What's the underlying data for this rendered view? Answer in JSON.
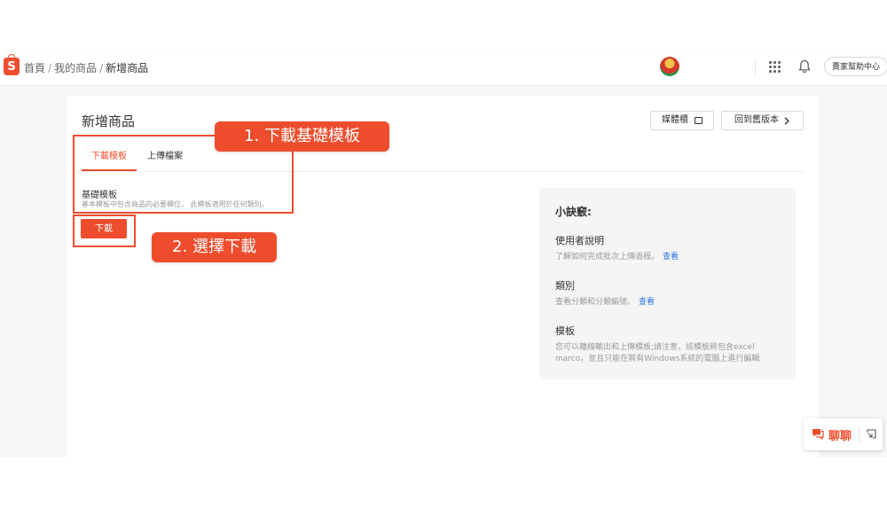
{
  "header": {
    "breadcrumb": {
      "home": "首頁",
      "products": "我的商品",
      "current": "新增商品",
      "separator": "/"
    },
    "help_label": "賣家幫助中心"
  },
  "page": {
    "title": "新增商品",
    "media_button": "媒體櫃",
    "back_button": "回到舊版本",
    "tabs": [
      {
        "label": "下載模板",
        "active": true
      },
      {
        "label": "上傳檔案",
        "active": false
      }
    ],
    "template": {
      "title": "基礎模板",
      "description": "基本模板中包含商品的必要欄位， 此模板適用於任何類別。",
      "download_button": "下載"
    }
  },
  "tips": {
    "heading": "小訣竅:",
    "items": [
      {
        "title": "使用者說明",
        "body": "了解如何完成批次上傳過程。",
        "link": "查看"
      },
      {
        "title": "類別",
        "body": "查看分類和分類編號。",
        "link": "查看"
      },
      {
        "title": "模板",
        "body": "您可以離線輸出和上傳模板;請注意，該模板將包含excel marco，並且只能在裝有Windows系統的電腦上進行編輯",
        "link": ""
      }
    ]
  },
  "annotations": {
    "step1": "1. 下載基礎模板",
    "step2": "2. 選擇下載"
  },
  "chat": {
    "label": "聊聊"
  },
  "colors": {
    "brand": "#ee4d2d",
    "link": "#2673dd",
    "page_bg": "#f6f6f6"
  }
}
